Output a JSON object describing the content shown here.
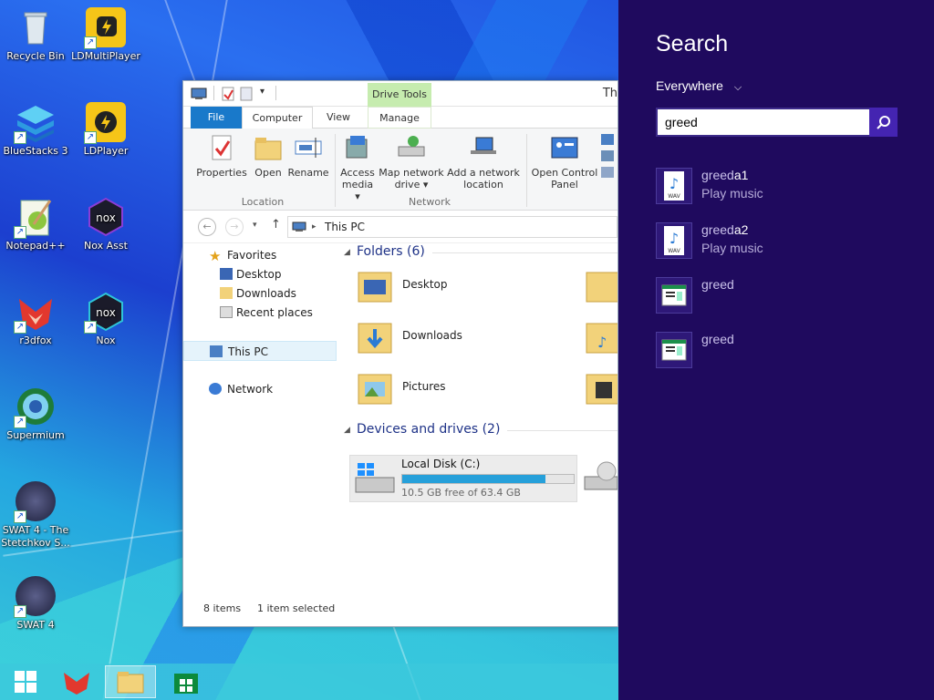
{
  "desktop": {
    "icons": [
      {
        "label": "Recycle Bin",
        "icon": "recycle-bin-icon"
      },
      {
        "label": "LDMultiPlayer",
        "icon": "ldmultiplayer-icon"
      },
      {
        "label": "BlueStacks 3",
        "icon": "bluestacks-icon"
      },
      {
        "label": "LDPlayer",
        "icon": "ldplayer-icon"
      },
      {
        "label": "Notepad++",
        "icon": "notepadpp-icon"
      },
      {
        "label": "Nox Asst",
        "icon": "nox-asst-icon"
      },
      {
        "label": "r3dfox",
        "icon": "r3dfox-icon"
      },
      {
        "label": "Nox",
        "icon": "nox-icon"
      },
      {
        "label": "Supermium",
        "icon": "supermium-icon"
      },
      {
        "label": "SWAT 4 - The Stetchkov S...",
        "icon": "swat4-expansion-icon"
      },
      {
        "label": "SWAT 4",
        "icon": "swat4-icon"
      }
    ]
  },
  "taskbar": {
    "items": [
      "start-button",
      "r3dfox",
      "file-explorer",
      "store"
    ]
  },
  "explorer": {
    "title": "Th",
    "contextual_tab": "Drive Tools",
    "tabs": {
      "file": "File",
      "computer": "Computer",
      "view": "View",
      "manage": "Manage"
    },
    "ribbon": {
      "properties": "Properties",
      "open": "Open",
      "rename": "Rename",
      "access_media": "Access media ▾",
      "map_network_drive": "Map network drive ▾",
      "add_network_location": "Add a network location",
      "open_control_panel": "Open Control Panel",
      "group_location": "Location",
      "group_network": "Network"
    },
    "address": "This PC",
    "nav": {
      "favorites": "Favorites",
      "desktop": "Desktop",
      "downloads": "Downloads",
      "recent": "Recent places",
      "this_pc": "This PC",
      "network": "Network"
    },
    "folders_header": "Folders (6)",
    "folders": [
      "Desktop",
      "Downloads",
      "Pictures"
    ],
    "devices_header": "Devices and drives (2)",
    "drive": {
      "name": "Local Disk (C:)",
      "free": "10.5 GB free of 63.4 GB",
      "used_fraction": 0.834
    },
    "status": {
      "items": "8 items",
      "selected": "1 item selected"
    }
  },
  "search": {
    "title": "Search",
    "scope": "Everywhere",
    "query": "greed",
    "results": [
      {
        "match": "greed",
        "rest": "a1",
        "sub": "Play music",
        "icon": "wav-file-icon"
      },
      {
        "match": "greed",
        "rest": "a2",
        "sub": "Play music",
        "icon": "wav-file-icon"
      },
      {
        "match": "greed",
        "rest": "",
        "sub": "",
        "icon": "app-window-icon"
      },
      {
        "match": "greed",
        "rest": "",
        "sub": "",
        "icon": "app-window-icon"
      }
    ]
  }
}
